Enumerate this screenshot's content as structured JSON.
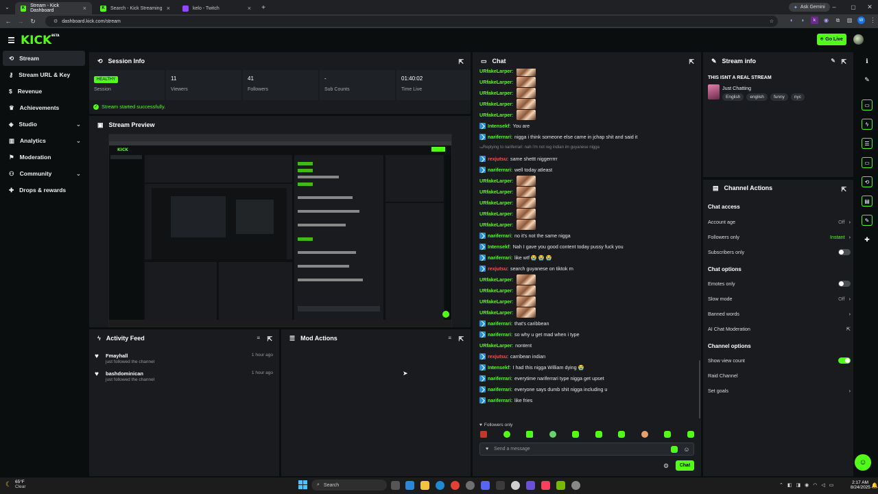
{
  "browser": {
    "tabs": [
      {
        "title": "Stream - Kick Dashboard"
      },
      {
        "title": "Search - Kick Streaming"
      },
      {
        "title": "kelo - Twitch"
      }
    ],
    "url": "dashboard.kick.com/stream",
    "ask_gemini": "Ask Gemini"
  },
  "header": {
    "logo": "KICK",
    "logo_sup": "BETA",
    "go_live": "Go Live"
  },
  "sidebar": {
    "items": [
      {
        "label": "Stream",
        "icon": "stream-icon",
        "active": true
      },
      {
        "label": "Stream URL & Key",
        "icon": "key-icon"
      },
      {
        "label": "Revenue",
        "icon": "dollar-icon"
      },
      {
        "label": "Achievements",
        "icon": "trophy-icon"
      },
      {
        "label": "Studio",
        "icon": "studio-icon",
        "expandable": true
      },
      {
        "label": "Analytics",
        "icon": "chart-icon",
        "expandable": true
      },
      {
        "label": "Moderation",
        "icon": "shield-icon"
      },
      {
        "label": "Community",
        "icon": "users-icon",
        "expandable": true
      },
      {
        "label": "Drops & rewards",
        "icon": "gift-icon"
      }
    ]
  },
  "session": {
    "title": "Session Info",
    "health": "HEALTHY",
    "health_label": "Session",
    "stats": [
      {
        "value": "11",
        "label": "Viewers"
      },
      {
        "value": "41",
        "label": "Followers"
      },
      {
        "value": "-",
        "label": "Sub Counts"
      },
      {
        "value": "01:40:02",
        "label": "Time Live"
      }
    ],
    "status": "Stream started successfully."
  },
  "preview": {
    "title": "Stream Preview"
  },
  "activity": {
    "title": "Activity Feed",
    "items": [
      {
        "name": "Fmayhall",
        "action": "just followed the channel",
        "time": "1 hour ago"
      },
      {
        "name": "bashdominican",
        "action": "just followed the channel",
        "time": "1 hour ago"
      }
    ]
  },
  "mod_actions": {
    "title": "Mod Actions"
  },
  "chat": {
    "title": "Chat",
    "messages": [
      {
        "user": "URfakeLarper",
        "color": "#53fc18",
        "badge": false,
        "text": "",
        "emote": true
      },
      {
        "user": "URfakeLarper",
        "color": "#53fc18",
        "badge": false,
        "text": "",
        "emote": true
      },
      {
        "user": "URfakeLarper",
        "color": "#53fc18",
        "badge": false,
        "text": "",
        "emote": true
      },
      {
        "user": "URfakeLarper",
        "color": "#53fc18",
        "badge": false,
        "text": "",
        "emote": true
      },
      {
        "user": "URfakeLarper",
        "color": "#53fc18",
        "badge": false,
        "text": "",
        "emote": true
      },
      {
        "user": "Intensekf",
        "color": "#53fc18",
        "badge": true,
        "text": "You are",
        "emote": false
      },
      {
        "user": "nariferrari",
        "color": "#53fc18",
        "badge": true,
        "text": "nigga i think someone else came in jchap shit and said it",
        "emote": false
      },
      {
        "reply": "Replying to nariferrari: nah i'm not reg indian im guyanese nigga"
      },
      {
        "user": "rexjutsu",
        "color": "#ff4d4d",
        "badge": true,
        "text": "same shettt niggerrrrr",
        "emote": false
      },
      {
        "user": "nariferrari",
        "color": "#53fc18",
        "badge": true,
        "text": "well today atleast",
        "emote": false
      },
      {
        "user": "URfakeLarper",
        "color": "#53fc18",
        "badge": false,
        "text": "",
        "emote": true
      },
      {
        "user": "URfakeLarper",
        "color": "#53fc18",
        "badge": false,
        "text": "",
        "emote": true
      },
      {
        "user": "URfakeLarper",
        "color": "#53fc18",
        "badge": false,
        "text": "",
        "emote": true
      },
      {
        "user": "URfakeLarper",
        "color": "#53fc18",
        "badge": false,
        "text": "",
        "emote": true
      },
      {
        "user": "URfakeLarper",
        "color": "#53fc18",
        "badge": false,
        "text": "",
        "emote": true
      },
      {
        "user": "nariferrari",
        "color": "#53fc18",
        "badge": true,
        "text": "no it's not the same nigga",
        "emote": false
      },
      {
        "user": "Intensekf",
        "color": "#53fc18",
        "badge": true,
        "text": "Nah I gave you good content today pussy fuck you",
        "emote": false
      },
      {
        "user": "nariferrari",
        "color": "#53fc18",
        "badge": true,
        "text": "like wtf 😭 😭 😭",
        "emote": false
      },
      {
        "user": "rexjutsu",
        "color": "#ff4d4d",
        "badge": true,
        "text": "search guyanese on tiktok rn",
        "emote": false
      },
      {
        "user": "URfakeLarper",
        "color": "#53fc18",
        "badge": false,
        "text": "",
        "emote": true
      },
      {
        "user": "URfakeLarper",
        "color": "#53fc18",
        "badge": false,
        "text": "",
        "emote": true
      },
      {
        "user": "URfakeLarper",
        "color": "#53fc18",
        "badge": false,
        "text": "",
        "emote": true
      },
      {
        "user": "URfakeLarper",
        "color": "#53fc18",
        "badge": false,
        "text": "",
        "emote": true
      },
      {
        "user": "nariferrari",
        "color": "#53fc18",
        "badge": true,
        "text": "that's caribbean",
        "emote": false
      },
      {
        "user": "nariferrari",
        "color": "#53fc18",
        "badge": true,
        "text": "so why u get mad when i type",
        "emote": false
      },
      {
        "user": "URfakeLarper",
        "color": "#53fc18",
        "badge": false,
        "text": "nontent",
        "emote": false
      },
      {
        "user": "rexjutsu",
        "color": "#ff4d4d",
        "badge": true,
        "text": "carribean indian",
        "emote": false
      },
      {
        "user": "Intensekf",
        "color": "#53fc18",
        "badge": true,
        "text": "I had this nigga William dying 😭",
        "emote": false
      },
      {
        "user": "nariferrari",
        "color": "#53fc18",
        "badge": true,
        "text": "everytime nariferrari type nigga get upset",
        "emote": false
      },
      {
        "user": "nariferrari",
        "color": "#53fc18",
        "badge": true,
        "text": "everyone says dumb shit nigga including u",
        "emote": false
      },
      {
        "user": "nariferrari",
        "color": "#53fc18",
        "badge": true,
        "text": "like fries",
        "emote": false
      }
    ],
    "followers_only": "Followers only",
    "input_placeholder": "Send a message",
    "send_label": "Chat"
  },
  "stream_info": {
    "title": "Stream info",
    "stream_title": "THIS ISNT A REAL STREAM",
    "category": "Just Chatting",
    "tags": [
      "English",
      "english",
      "funny",
      "nyc"
    ]
  },
  "channel_actions": {
    "title": "Channel Actions",
    "chat_access": "Chat access",
    "account_age": {
      "label": "Account age",
      "value": "Off"
    },
    "followers_only": {
      "label": "Followers only",
      "value": "Instant"
    },
    "subscribers_only": {
      "label": "Subscribers only"
    },
    "chat_options": "Chat options",
    "emotes_only": {
      "label": "Emotes only"
    },
    "slow_mode": {
      "label": "Slow mode",
      "value": "Off"
    },
    "banned_words": {
      "label": "Banned words"
    },
    "ai_moderation": {
      "label": "AI Chat Moderation"
    },
    "channel_options": "Channel options",
    "show_view_count": {
      "label": "Show view count"
    },
    "raid_channel": {
      "label": "Raid Channel"
    },
    "set_goals": {
      "label": "Set goals"
    }
  },
  "taskbar": {
    "weather_temp": "65°F",
    "weather_desc": "Clear",
    "search": "Search",
    "time": "2:17 AM",
    "date": "8/24/2025"
  },
  "colors": {
    "accent": "#53fc18",
    "panel": "#191b1f",
    "bg": "#0b0e0f"
  }
}
